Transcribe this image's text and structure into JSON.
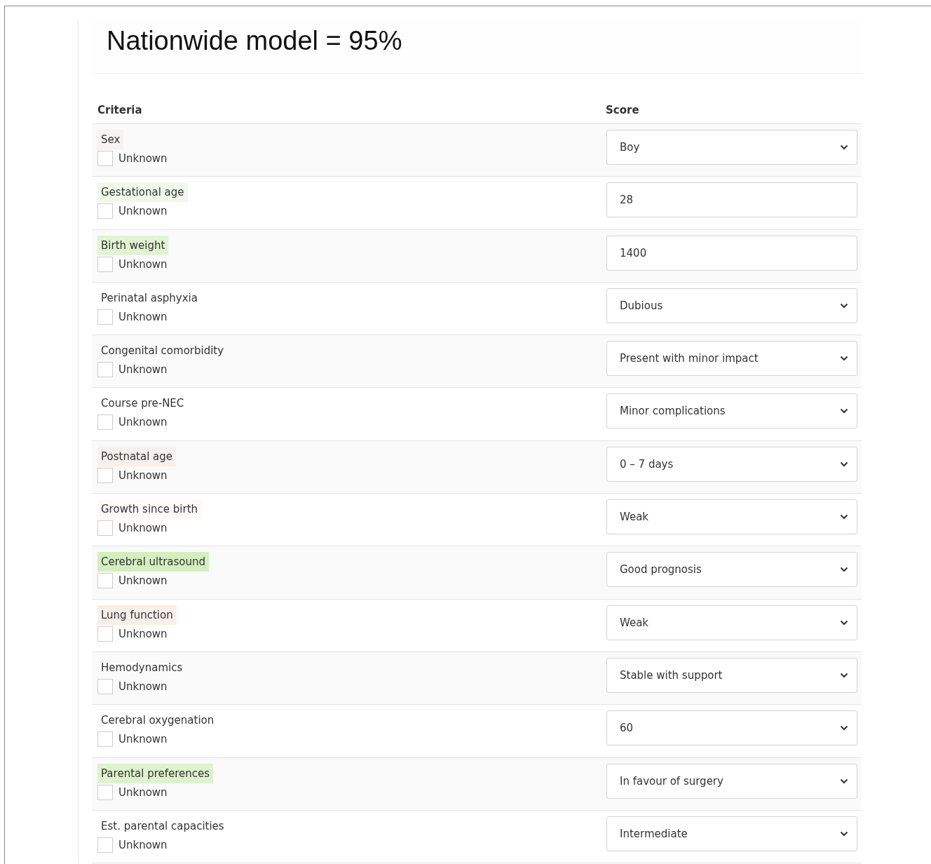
{
  "title": "Nationwide model = 95%",
  "table": {
    "columns": [
      "Criteria",
      "Score"
    ],
    "rows": [
      {
        "criterion": "Sex",
        "color": "#f5f4f2",
        "unknown_label": "Unknown",
        "unknown_checked": false,
        "kind": "select",
        "value": "Boy"
      },
      {
        "criterion": "Gestational age",
        "color": "#f2f8ec",
        "unknown_label": "Unknown",
        "unknown_checked": false,
        "kind": "input",
        "value": "28"
      },
      {
        "criterion": "Birth weight",
        "color": "#e2f3d4",
        "unknown_label": "Unknown",
        "unknown_checked": false,
        "kind": "input",
        "value": "1400"
      },
      {
        "criterion": "Perinatal asphyxia",
        "unknown_label": "Unknown",
        "unknown_checked": false,
        "kind": "select",
        "value": "Dubious"
      },
      {
        "criterion": "Congenital comorbidity",
        "unknown_label": "Unknown",
        "unknown_checked": false,
        "kind": "select",
        "value": "Present with minor impact"
      },
      {
        "criterion": "Course pre-NEC",
        "unknown_label": "Unknown",
        "unknown_checked": false,
        "kind": "select",
        "value": "Minor complications"
      },
      {
        "criterion": "Postnatal age",
        "color": "#f6f1ec",
        "unknown_label": "Unknown",
        "unknown_checked": false,
        "kind": "select",
        "value": "0 – 7 days"
      },
      {
        "criterion": "Growth since birth",
        "color": "#fbfaf7",
        "unknown_label": "Unknown",
        "unknown_checked": false,
        "kind": "select",
        "value": "Weak"
      },
      {
        "criterion": "Cerebral ultrasound",
        "color": "#d3efc0",
        "unknown_label": "Unknown",
        "unknown_checked": false,
        "kind": "select",
        "value": "Good prognosis"
      },
      {
        "criterion": "Lung function",
        "color": "#f6efea",
        "unknown_label": "Unknown",
        "unknown_checked": false,
        "kind": "select",
        "value": "Weak"
      },
      {
        "criterion": "Hemodynamics",
        "unknown_label": "Unknown",
        "unknown_checked": false,
        "kind": "select",
        "value": "Stable with support"
      },
      {
        "criterion": "Cerebral oxygenation",
        "unknown_label": "Unknown",
        "unknown_checked": false,
        "kind": "select",
        "value": "60"
      },
      {
        "criterion": "Parental preferences",
        "color": "#ddf2cd",
        "unknown_label": "Unknown",
        "unknown_checked": false,
        "kind": "select",
        "value": "In favour of surgery"
      },
      {
        "criterion": "Est. parental capacities",
        "unknown_label": "Unknown",
        "unknown_checked": false,
        "kind": "select",
        "value": "Intermediate"
      }
    ]
  }
}
